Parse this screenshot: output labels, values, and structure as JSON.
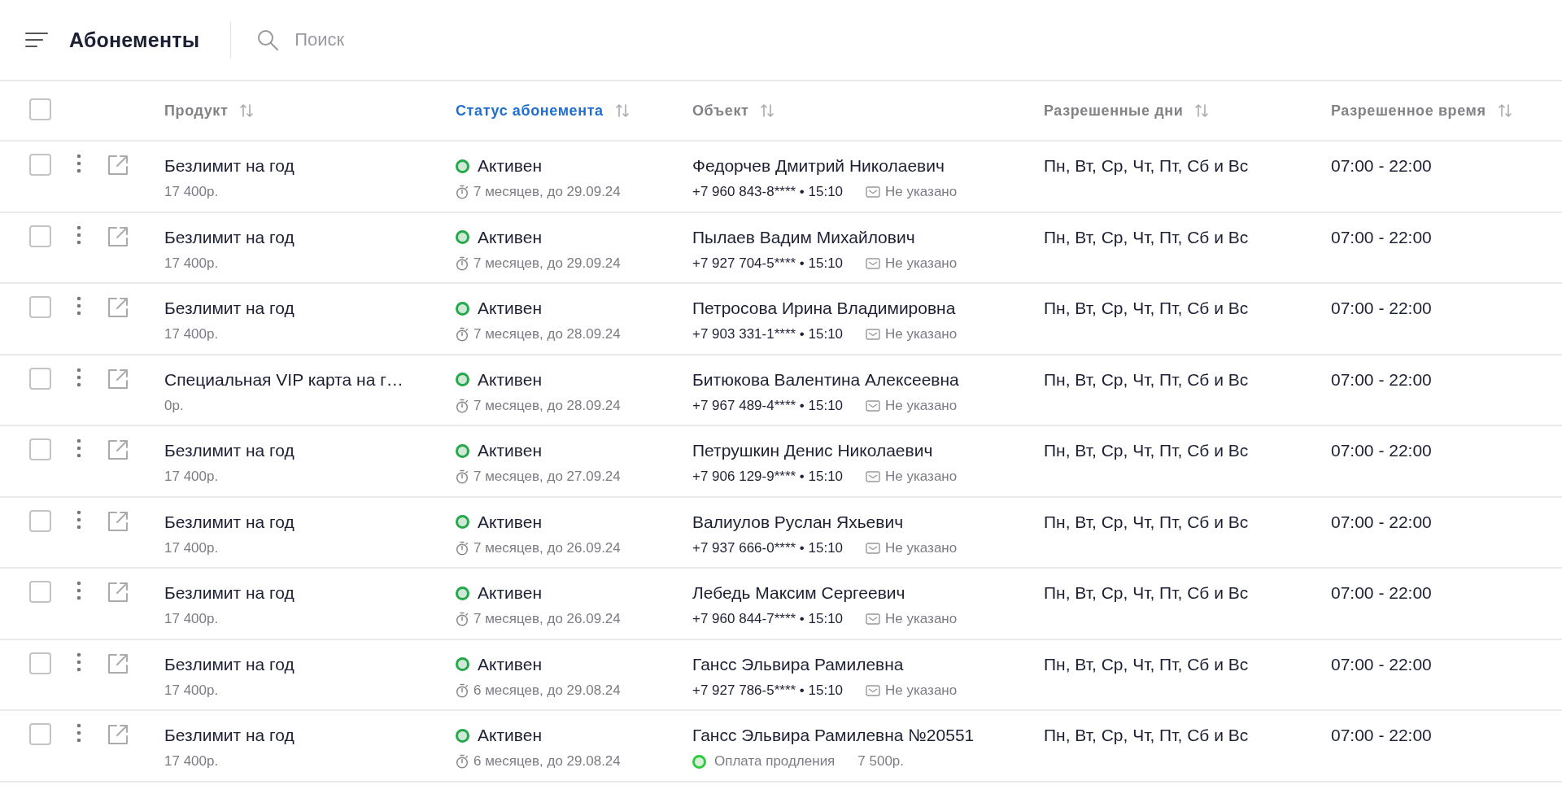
{
  "topbar": {
    "title": "Абонементы",
    "search": {
      "placeholder": "Поиск"
    }
  },
  "table": {
    "all_checked": false,
    "columns": [
      {
        "label": "Продукт",
        "selected": false
      },
      {
        "label": "Статус абонемента",
        "selected": true
      },
      {
        "label": "Объект",
        "selected": false
      },
      {
        "label": "Разрешенные дни",
        "selected": false
      },
      {
        "label": "Разрешенное время",
        "selected": false
      }
    ],
    "rows": [
      {
        "checked": false,
        "product": "Безлимит на год",
        "price": "17 400р.",
        "status": "Активен",
        "term": "7 месяцев, до 29.09.24",
        "name": "Федорчев Дмитрий Николаевич",
        "contact": {
          "kind": "contact",
          "phone": "+7 960 843-8**** • 15:10",
          "email": "Не указано"
        },
        "days": "Пн, Вт, Ср, Чт, Пт, Сб и Вс",
        "time": "07:00 - 22:00"
      },
      {
        "checked": false,
        "product": "Безлимит на год",
        "price": "17 400р.",
        "status": "Активен",
        "term": "7 месяцев, до 29.09.24",
        "name": "Пылаев Вадим Михайлович",
        "contact": {
          "kind": "contact",
          "phone": "+7 927 704-5**** • 15:10",
          "email": "Не указано"
        },
        "days": "Пн, Вт, Ср, Чт, Пт, Сб и Вс",
        "time": "07:00 - 22:00"
      },
      {
        "checked": false,
        "product": "Безлимит на год",
        "price": "17 400р.",
        "status": "Активен",
        "term": "7 месяцев, до 28.09.24",
        "name": "Петросова Ирина Владимировна",
        "contact": {
          "kind": "contact",
          "phone": "+7 903 331-1**** • 15:10",
          "email": "Не указано"
        },
        "days": "Пн, Вт, Ср, Чт, Пт, Сб и Вс",
        "time": "07:00 - 22:00"
      },
      {
        "checked": false,
        "product": "Специальная VIP карта на г…",
        "price": "0р.",
        "status": "Активен",
        "term": "7 месяцев, до 28.09.24",
        "name": "Битюкова Валентина Алексеевна",
        "contact": {
          "kind": "contact",
          "phone": "+7 967 489-4**** • 15:10",
          "email": "Не указано"
        },
        "days": "Пн, Вт, Ср, Чт, Пт, Сб и Вс",
        "time": "07:00 - 22:00"
      },
      {
        "checked": false,
        "product": "Безлимит на год",
        "price": "17 400р.",
        "status": "Активен",
        "term": "7 месяцев, до 27.09.24",
        "name": "Петрушкин Денис Николаевич",
        "contact": {
          "kind": "contact",
          "phone": "+7 906 129-9**** • 15:10",
          "email": "Не указано"
        },
        "days": "Пн, Вт, Ср, Чт, Пт, Сб и Вс",
        "time": "07:00 - 22:00"
      },
      {
        "checked": false,
        "product": "Безлимит на год",
        "price": "17 400р.",
        "status": "Активен",
        "term": "7 месяцев, до 26.09.24",
        "name": "Валиулов Руслан Яхьевич",
        "contact": {
          "kind": "contact",
          "phone": "+7 937 666-0**** • 15:10",
          "email": "Не указано"
        },
        "days": "Пн, Вт, Ср, Чт, Пт, Сб и Вс",
        "time": "07:00 - 22:00"
      },
      {
        "checked": false,
        "product": "Безлимит на год",
        "price": "17 400р.",
        "status": "Активен",
        "term": "7 месяцев, до 26.09.24",
        "name": "Лебедь Максим Сергеевич",
        "contact": {
          "kind": "contact",
          "phone": "+7 960 844-7**** • 15:10",
          "email": "Не указано"
        },
        "days": "Пн, Вт, Ср, Чт, Пт, Сб и Вс",
        "time": "07:00 - 22:00"
      },
      {
        "checked": false,
        "product": "Безлимит на год",
        "price": "17 400р.",
        "status": "Активен",
        "term": "6 месяцев, до 29.08.24",
        "name": "Гансс Эльвира Рамилевна",
        "contact": {
          "kind": "contact",
          "phone": "+7 927 786-5**** • 15:10",
          "email": "Не указано"
        },
        "days": "Пн, Вт, Ср, Чт, Пт, Сб и Вс",
        "time": "07:00 - 22:00"
      },
      {
        "checked": false,
        "product": "Безлимит на год",
        "price": "17 400р.",
        "status": "Активен",
        "term": "6 месяцев, до 29.08.24",
        "name": "Гансс Эльвира Рамилевна №20551",
        "contact": {
          "kind": "payment",
          "label": "Оплата продления",
          "amount": "7 500р."
        },
        "days": "Пн, Вт, Ср, Чт, Пт, Сб и Вс",
        "time": "07:00 - 22:00"
      }
    ]
  }
}
